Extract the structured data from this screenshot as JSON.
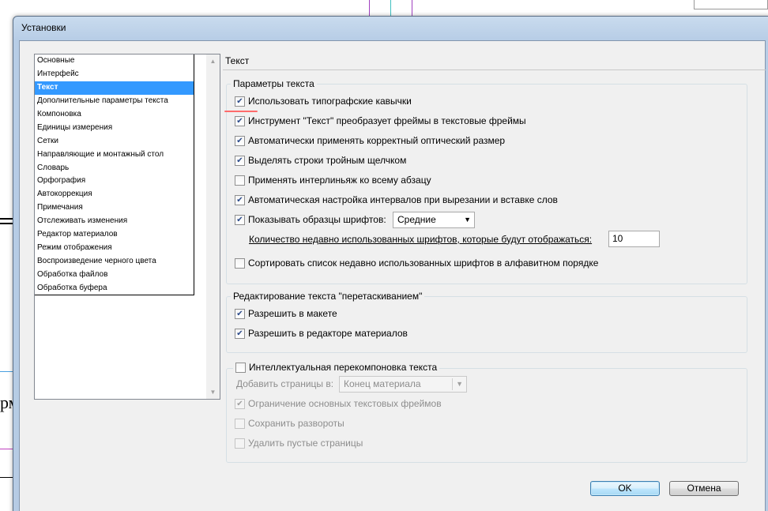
{
  "window": {
    "title": "Установки"
  },
  "nav": {
    "items": [
      "Основные",
      "Интерфейс",
      "Текст",
      "Дополнительные параметры текста",
      "Компоновка",
      "Единицы измерения",
      "Сетки",
      "Направляющие и монтажный стол",
      "Словарь",
      "Орфография",
      "Автокоррекция",
      "Примечания",
      "Отслеживать изменения",
      "Редактор материалов",
      "Режим отображения",
      "Воспроизведение черного цвета",
      "Обработка файлов",
      "Обработка буфера"
    ],
    "selected_index": 2
  },
  "panel": {
    "title": "Текст"
  },
  "text_options": {
    "legend": "Параметры текста",
    "typographic_quotes": {
      "label": "Использовать типографские кавычки",
      "checked": true
    },
    "type_tool_converts": {
      "label": "Инструмент \"Текст\" преобразует фреймы в текстовые фреймы",
      "checked": true
    },
    "auto_optical_size": {
      "label": "Автоматически применять корректный оптический размер",
      "checked": true
    },
    "triple_click_line": {
      "label": "Выделять строки тройным щелчком",
      "checked": true
    },
    "leading_whole_para": {
      "label": "Применять интерлиньяж ко всему абзацу",
      "checked": false
    },
    "adjust_spacing": {
      "label": "Автоматическая настройка интервалов при вырезании и вставке слов",
      "checked": true
    },
    "font_preview": {
      "label": "Показывать образцы шрифтов:",
      "checked": true,
      "size_value": "Средние"
    },
    "recent_fonts": {
      "label": "Количество недавно использованных шрифтов, которые будут отображаться:",
      "value": "10"
    },
    "sort_recent": {
      "label": "Сортировать список недавно использованных шрифтов в алфавитном порядке",
      "checked": false
    }
  },
  "drag_drop": {
    "legend": "Редактирование текста \"перетаскиванием\"",
    "in_layout": {
      "label": "Разрешить в макете",
      "checked": true
    },
    "in_story_editor": {
      "label": "Разрешить в редакторе материалов",
      "checked": true
    }
  },
  "smart_reflow": {
    "legend": "Интеллектуальная перекомпоновка текста",
    "enabled": false,
    "add_pages_label": "Добавить страницы в:",
    "add_pages_value": "Конец материала",
    "limit_primary": {
      "label": "Ограничение основных текстовых фреймов",
      "checked": true
    },
    "preserve_spreads": {
      "label": "Сохранить развороты",
      "checked": false
    },
    "delete_empty": {
      "label": "Удалить пустые страницы",
      "checked": false
    }
  },
  "buttons": {
    "ok": "OK",
    "cancel": "Отмена"
  },
  "background": {
    "text": "рм"
  }
}
